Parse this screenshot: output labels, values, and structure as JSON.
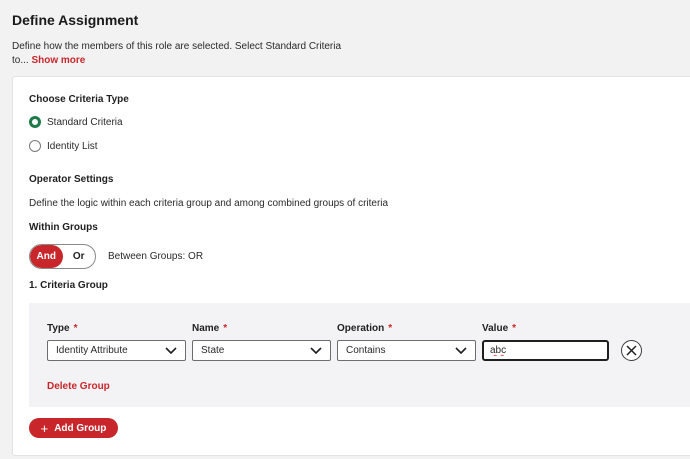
{
  "header": {
    "title": "Define Assignment",
    "description": "Define how the members of this role are selected. Select Standard Criteria to...",
    "show_more": "Show more"
  },
  "criteria_type": {
    "label": "Choose Criteria Type",
    "options": [
      {
        "label": "Standard Criteria",
        "selected": true
      },
      {
        "label": "Identity List",
        "selected": false
      }
    ]
  },
  "operator_settings": {
    "label": "Operator Settings",
    "description": "Define the logic within each criteria group and among combined groups of criteria",
    "within_groups_label": "Within Groups",
    "toggle": {
      "and_label": "And",
      "or_label": "Or",
      "selected": "And"
    },
    "between_groups": "Between Groups: OR"
  },
  "criteria_group": {
    "title": "1. Criteria Group",
    "fields": {
      "type": {
        "label": "Type",
        "value": "Identity Attribute"
      },
      "name": {
        "label": "Name",
        "value": "State"
      },
      "operation": {
        "label": "Operation",
        "value": "Contains"
      },
      "value": {
        "label": "Value",
        "value": "abc"
      }
    },
    "required_mark": "*",
    "delete_label": "Delete Group"
  },
  "add_group_label": "Add Group",
  "colors": {
    "accent": "#c8262b",
    "radio_selected": "#1f7a4a"
  }
}
